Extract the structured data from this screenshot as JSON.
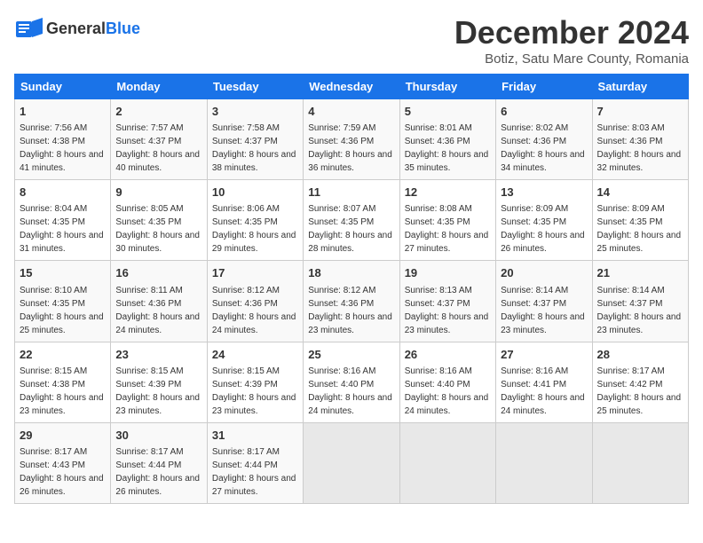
{
  "header": {
    "logo_general": "General",
    "logo_blue": "Blue",
    "month_title": "December 2024",
    "location": "Botiz, Satu Mare County, Romania"
  },
  "days_of_week": [
    "Sunday",
    "Monday",
    "Tuesday",
    "Wednesday",
    "Thursday",
    "Friday",
    "Saturday"
  ],
  "weeks": [
    [
      {
        "day": "1",
        "sunrise": "7:56 AM",
        "sunset": "4:38 PM",
        "daylight": "8 hours and 41 minutes."
      },
      {
        "day": "2",
        "sunrise": "7:57 AM",
        "sunset": "4:37 PM",
        "daylight": "8 hours and 40 minutes."
      },
      {
        "day": "3",
        "sunrise": "7:58 AM",
        "sunset": "4:37 PM",
        "daylight": "8 hours and 38 minutes."
      },
      {
        "day": "4",
        "sunrise": "7:59 AM",
        "sunset": "4:36 PM",
        "daylight": "8 hours and 36 minutes."
      },
      {
        "day": "5",
        "sunrise": "8:01 AM",
        "sunset": "4:36 PM",
        "daylight": "8 hours and 35 minutes."
      },
      {
        "day": "6",
        "sunrise": "8:02 AM",
        "sunset": "4:36 PM",
        "daylight": "8 hours and 34 minutes."
      },
      {
        "day": "7",
        "sunrise": "8:03 AM",
        "sunset": "4:36 PM",
        "daylight": "8 hours and 32 minutes."
      }
    ],
    [
      {
        "day": "8",
        "sunrise": "8:04 AM",
        "sunset": "4:35 PM",
        "daylight": "8 hours and 31 minutes."
      },
      {
        "day": "9",
        "sunrise": "8:05 AM",
        "sunset": "4:35 PM",
        "daylight": "8 hours and 30 minutes."
      },
      {
        "day": "10",
        "sunrise": "8:06 AM",
        "sunset": "4:35 PM",
        "daylight": "8 hours and 29 minutes."
      },
      {
        "day": "11",
        "sunrise": "8:07 AM",
        "sunset": "4:35 PM",
        "daylight": "8 hours and 28 minutes."
      },
      {
        "day": "12",
        "sunrise": "8:08 AM",
        "sunset": "4:35 PM",
        "daylight": "8 hours and 27 minutes."
      },
      {
        "day": "13",
        "sunrise": "8:09 AM",
        "sunset": "4:35 PM",
        "daylight": "8 hours and 26 minutes."
      },
      {
        "day": "14",
        "sunrise": "8:09 AM",
        "sunset": "4:35 PM",
        "daylight": "8 hours and 25 minutes."
      }
    ],
    [
      {
        "day": "15",
        "sunrise": "8:10 AM",
        "sunset": "4:35 PM",
        "daylight": "8 hours and 25 minutes."
      },
      {
        "day": "16",
        "sunrise": "8:11 AM",
        "sunset": "4:36 PM",
        "daylight": "8 hours and 24 minutes."
      },
      {
        "day": "17",
        "sunrise": "8:12 AM",
        "sunset": "4:36 PM",
        "daylight": "8 hours and 24 minutes."
      },
      {
        "day": "18",
        "sunrise": "8:12 AM",
        "sunset": "4:36 PM",
        "daylight": "8 hours and 23 minutes."
      },
      {
        "day": "19",
        "sunrise": "8:13 AM",
        "sunset": "4:37 PM",
        "daylight": "8 hours and 23 minutes."
      },
      {
        "day": "20",
        "sunrise": "8:14 AM",
        "sunset": "4:37 PM",
        "daylight": "8 hours and 23 minutes."
      },
      {
        "day": "21",
        "sunrise": "8:14 AM",
        "sunset": "4:37 PM",
        "daylight": "8 hours and 23 minutes."
      }
    ],
    [
      {
        "day": "22",
        "sunrise": "8:15 AM",
        "sunset": "4:38 PM",
        "daylight": "8 hours and 23 minutes."
      },
      {
        "day": "23",
        "sunrise": "8:15 AM",
        "sunset": "4:39 PM",
        "daylight": "8 hours and 23 minutes."
      },
      {
        "day": "24",
        "sunrise": "8:15 AM",
        "sunset": "4:39 PM",
        "daylight": "8 hours and 23 minutes."
      },
      {
        "day": "25",
        "sunrise": "8:16 AM",
        "sunset": "4:40 PM",
        "daylight": "8 hours and 24 minutes."
      },
      {
        "day": "26",
        "sunrise": "8:16 AM",
        "sunset": "4:40 PM",
        "daylight": "8 hours and 24 minutes."
      },
      {
        "day": "27",
        "sunrise": "8:16 AM",
        "sunset": "4:41 PM",
        "daylight": "8 hours and 24 minutes."
      },
      {
        "day": "28",
        "sunrise": "8:17 AM",
        "sunset": "4:42 PM",
        "daylight": "8 hours and 25 minutes."
      }
    ],
    [
      {
        "day": "29",
        "sunrise": "8:17 AM",
        "sunset": "4:43 PM",
        "daylight": "8 hours and 26 minutes."
      },
      {
        "day": "30",
        "sunrise": "8:17 AM",
        "sunset": "4:44 PM",
        "daylight": "8 hours and 26 minutes."
      },
      {
        "day": "31",
        "sunrise": "8:17 AM",
        "sunset": "4:44 PM",
        "daylight": "8 hours and 27 minutes."
      },
      null,
      null,
      null,
      null
    ]
  ]
}
